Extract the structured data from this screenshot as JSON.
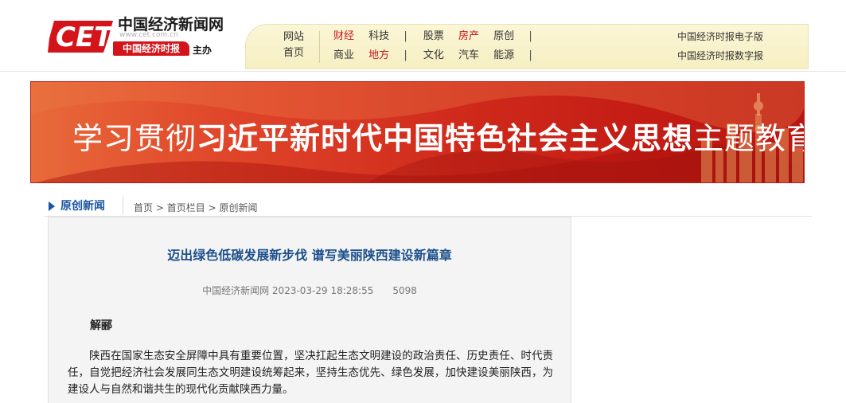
{
  "logo": {
    "mark": "CET",
    "site_name": "中国经济新闻网",
    "url": "www.cet.com.cn",
    "paper_name": "中国经济时报",
    "host_label": "主办"
  },
  "nav": {
    "home_line1": "网站",
    "home_line2": "首页",
    "row1": [
      {
        "label": "财经",
        "highlight": true
      },
      {
        "label": "科技",
        "highlight": false
      },
      {
        "label": "|",
        "sep": true
      },
      {
        "label": "股票",
        "highlight": false
      },
      {
        "label": "房产",
        "highlight": true
      },
      {
        "label": "原创",
        "highlight": false
      },
      {
        "label": "|",
        "sep": true
      }
    ],
    "row2": [
      {
        "label": "商业",
        "highlight": false
      },
      {
        "label": "地方",
        "highlight": true
      },
      {
        "label": "|",
        "sep": true
      },
      {
        "label": "文化",
        "highlight": false
      },
      {
        "label": "汽车",
        "highlight": false
      },
      {
        "label": "能源",
        "highlight": false
      },
      {
        "label": "|",
        "sep": true
      }
    ],
    "right1": "中国经济时报电子版",
    "right2": "中国经济时报数字报",
    "accent": "#c8161d"
  },
  "banner": {
    "part1": "学习贯彻",
    "part2": "习近平新时代中国特色社会主义思想",
    "part3": "主题教育"
  },
  "section": {
    "title": "原创新闻",
    "breadcrumb": [
      "首页",
      "首页栏目",
      "原创新闻"
    ],
    "breadcrumb_sep": ">"
  },
  "article": {
    "title": "迈出绿色低碳发展新步伐 谱写美丽陕西建设新篇章",
    "source": "中国经济新闻网",
    "datetime": "2023-03-29 18:28:55",
    "views": "5098",
    "author": "解郦",
    "body": "陕西在国家生态安全屏障中具有重要位置，坚决扛起生态文明建设的政治责任、历史责任、时代责任，自觉把经济社会发展同生态文明建设统筹起来，坚持生态优先、绿色发展，加快建设美丽陕西，为建设人与自然和谐共生的现代化贡献陕西力量。"
  }
}
